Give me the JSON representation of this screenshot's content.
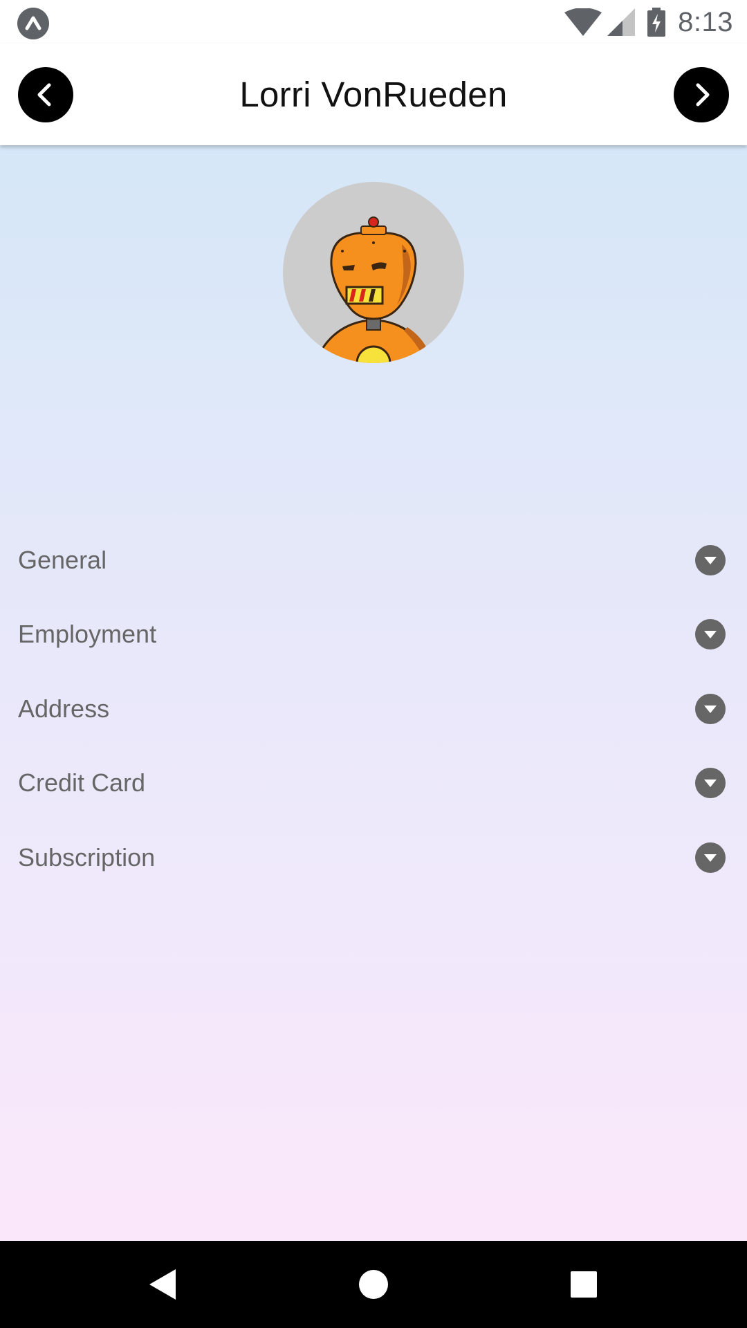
{
  "status_bar": {
    "time": "8:13",
    "icons": [
      "app-badge-icon",
      "wifi-icon",
      "signal-icon",
      "battery-charging-icon"
    ]
  },
  "header": {
    "title": "Lorri VonRueden",
    "prev_icon": "chevron-left-icon",
    "next_icon": "chevron-right-icon"
  },
  "profile": {
    "avatar_icon": "robot-avatar-icon"
  },
  "sections": [
    {
      "label": "General"
    },
    {
      "label": "Employment"
    },
    {
      "label": "Address"
    },
    {
      "label": "Credit Card"
    },
    {
      "label": "Subscription"
    }
  ],
  "system_nav": {
    "icons": [
      "back-triangle-icon",
      "home-circle-icon",
      "recents-square-icon"
    ]
  },
  "colors": {
    "gradient_top": "#d5e7f8",
    "gradient_bottom": "#fbe7fa",
    "label_gray": "#666666",
    "avatar_bg": "#cccccc",
    "robot_orange": "#f5901e"
  }
}
